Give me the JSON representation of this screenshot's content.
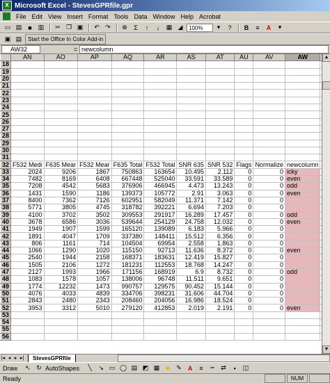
{
  "window": {
    "title": "Microsoft Excel - StevesGPRfile.gpr"
  },
  "menu": [
    "File",
    "Edit",
    "View",
    "Insert",
    "Format",
    "Tools",
    "Data",
    "Window",
    "Help",
    "Acrobat"
  ],
  "toolbar": {
    "zoom": "100%"
  },
  "addin_bar": {
    "label": "Start the Office In Color Add-in"
  },
  "formula_bar": {
    "name_box": "AW32",
    "formula": "newcolumn"
  },
  "columns": [
    "AN",
    "AO",
    "AP",
    "AQ",
    "AR",
    "AS",
    "AT",
    "AU",
    "AV",
    "AW"
  ],
  "empty_rows": [
    "18",
    "19",
    "20",
    "21",
    "22",
    "23",
    "24",
    "25",
    "26",
    "27",
    "28",
    "29",
    "30",
    "31"
  ],
  "header_row": {
    "row": "32",
    "cells": [
      "F532 Medi",
      "F635 Mear",
      "F532 Mear",
      "F635 Total",
      "F532 Total",
      "SNR 635",
      "SNR 532",
      "Flags",
      "Normalize",
      "newcolumn"
    ]
  },
  "data_rows": [
    {
      "row": "33",
      "cells": [
        "2024",
        "9206",
        "1867",
        "750863",
        "163654",
        "10.495",
        "2.112",
        "0",
        "0",
        "icky"
      ]
    },
    {
      "row": "34",
      "cells": [
        "7482",
        "8169",
        "6408",
        "667448",
        "525040",
        "33.591",
        "33.589",
        "0",
        "0",
        "even"
      ]
    },
    {
      "row": "35",
      "cells": [
        "7208",
        "4542",
        "5683",
        "376906",
        "466945",
        "4.473",
        "13.243",
        "0",
        "0",
        "odd"
      ]
    },
    {
      "row": "36",
      "cells": [
        "1431",
        "1590",
        "1186",
        "139373",
        "105772",
        "2.91",
        "3.063",
        "0",
        "0",
        "even"
      ]
    },
    {
      "row": "37",
      "cells": [
        "8400",
        "7362",
        "7126",
        "602951",
        "582049",
        "11.371",
        "7.142",
        "0",
        "0",
        ""
      ]
    },
    {
      "row": "38",
      "cells": [
        "5771",
        "3805",
        "4745",
        "318782",
        "392221",
        "6.694",
        "7.203",
        "0",
        "0",
        ""
      ]
    },
    {
      "row": "39",
      "cells": [
        "4100",
        "3702",
        "3502",
        "309553",
        "291917",
        "16.289",
        "17.457",
        "0",
        "0",
        "odd"
      ]
    },
    {
      "row": "40",
      "cells": [
        "3678",
        "6586",
        "3036",
        "539644",
        "254129",
        "24.758",
        "12.032",
        "0",
        "0",
        "even"
      ]
    },
    {
      "row": "41",
      "cells": [
        "1949",
        "1907",
        "1599",
        "165120",
        "139089",
        "6.183",
        "5.966",
        "0",
        "0",
        ""
      ]
    },
    {
      "row": "42",
      "cells": [
        "1891",
        "4047",
        "1709",
        "337380",
        "148411",
        "15.512",
        "6.356",
        "0",
        "0",
        ""
      ]
    },
    {
      "row": "43",
      "cells": [
        "806",
        "1161",
        "714",
        "104504",
        "69954",
        "2.558",
        "1.863",
        "0",
        "0",
        ""
      ]
    },
    {
      "row": "44",
      "cells": [
        "1066",
        "1290",
        "1020",
        "115150",
        "92713",
        "11.636",
        "8.372",
        "0",
        "0",
        "even"
      ]
    },
    {
      "row": "45",
      "cells": [
        "2540",
        "1944",
        "2158",
        "168371",
        "183631",
        "12.419",
        "15.827",
        "0",
        "0",
        ""
      ]
    },
    {
      "row": "46",
      "cells": [
        "1505",
        "2106",
        "1272",
        "181231",
        "112553",
        "18.768",
        "14.247",
        "0",
        "0",
        ""
      ]
    },
    {
      "row": "47",
      "cells": [
        "2127",
        "1993",
        "1966",
        "171156",
        "168919",
        "6.9",
        "8.732",
        "0",
        "0",
        "odd"
      ]
    },
    {
      "row": "48",
      "cells": [
        "1083",
        "1578",
        "1057",
        "138006",
        "96748",
        "11.511",
        "9.651",
        "0",
        "0",
        ""
      ]
    },
    {
      "row": "49",
      "cells": [
        "1774",
        "12232",
        "1473",
        "990757",
        "129575",
        "90.452",
        "15.144",
        "0",
        "0",
        ""
      ]
    },
    {
      "row": "50",
      "cells": [
        "4076",
        "4033",
        "4839",
        "334706",
        "398231",
        "31.606",
        "44.704",
        "0",
        "0",
        ""
      ]
    },
    {
      "row": "51",
      "cells": [
        "2843",
        "2480",
        "2343",
        "208460",
        "204056",
        "16.986",
        "18.524",
        "0",
        "0",
        ""
      ]
    },
    {
      "row": "52",
      "cells": [
        "3953",
        "3312",
        "5010",
        "279120",
        "412853",
        "2.019",
        "2.191",
        "0",
        "0",
        "even"
      ]
    }
  ],
  "trailing_rows": [
    "53",
    "54",
    "55",
    "56"
  ],
  "sheet_tab": {
    "name": "StevesGPRfile"
  },
  "drawing_toolbar": {
    "draw": "Draw",
    "autoshapes": "AutoShapes"
  },
  "status": {
    "text": "Ready",
    "num": "NUM"
  }
}
